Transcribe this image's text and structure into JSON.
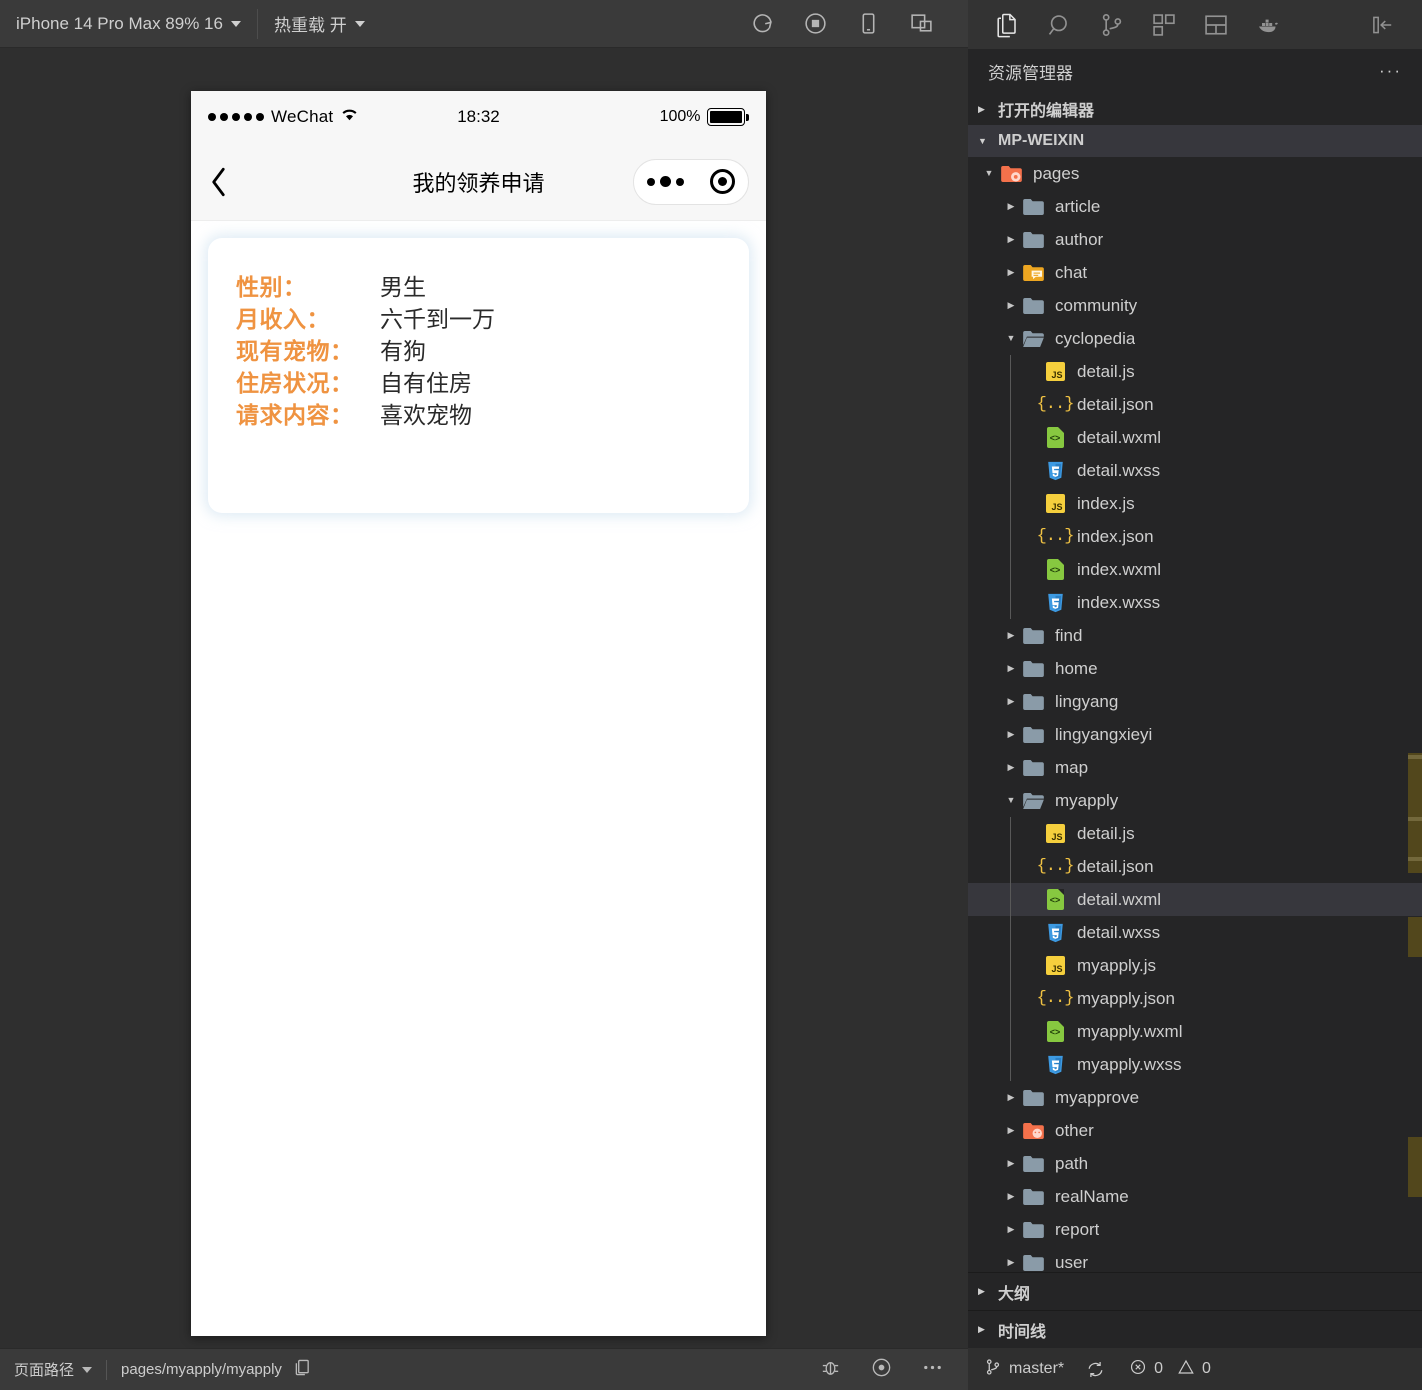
{
  "simulator": {
    "toolbar": {
      "device_label": "iPhone 14 Pro Max 89% 16",
      "hot_reload_label": "热重载 开",
      "icons": [
        "refresh-icon",
        "record-stop-icon",
        "phone-icon",
        "split-window-icon"
      ]
    },
    "phone": {
      "status_bar": {
        "carrier": "WeChat",
        "time": "18:32",
        "battery_percent": "100%"
      },
      "nav": {
        "back_icon": "chevron-left-icon",
        "title": "我的领养申请",
        "capsule": {
          "more_icon": "more-dots-icon",
          "target_icon": "target-circle-icon"
        }
      },
      "card": {
        "rows": [
          {
            "label": "性别：",
            "value": "男生"
          },
          {
            "label": "月收入：",
            "value": "六千到一万"
          },
          {
            "label": "现有宠物：",
            "value": "有狗"
          },
          {
            "label": "住房状况：",
            "value": "自有住房"
          },
          {
            "label": "请求内容：",
            "value": "喜欢宠物"
          }
        ]
      }
    },
    "bottom_bar": {
      "path_label": "页面路径",
      "path_value": "pages/myapply/myapply",
      "copy_icon": "copy-icon",
      "icons": [
        "debug-bug-icon",
        "eye-icon",
        "more-horizontal-icon"
      ]
    }
  },
  "vscode": {
    "activity_bar": {
      "items": [
        {
          "name": "explorer-icon",
          "active": true
        },
        {
          "name": "search-icon",
          "active": false
        },
        {
          "name": "source-control-icon",
          "active": false
        },
        {
          "name": "extensions-icon",
          "active": false
        },
        {
          "name": "layout-icon",
          "active": false
        },
        {
          "name": "docker-icon",
          "active": false
        }
      ],
      "collapse_icon": "collapse-panel-icon"
    },
    "panel_title": "资源管理器",
    "panel_more": "···",
    "sections": [
      {
        "label": "打开的编辑器",
        "expanded": false
      },
      {
        "label": "MP-WEIXIN",
        "expanded": true,
        "highlight": true
      }
    ],
    "tree": [
      {
        "name": "pages",
        "type": "folder-special",
        "depth": 1,
        "expanded": true
      },
      {
        "name": "article",
        "type": "folder",
        "depth": 2,
        "expanded": false
      },
      {
        "name": "author",
        "type": "folder",
        "depth": 2,
        "expanded": false
      },
      {
        "name": "chat",
        "type": "folder-chat",
        "depth": 2,
        "expanded": false
      },
      {
        "name": "community",
        "type": "folder",
        "depth": 2,
        "expanded": false
      },
      {
        "name": "cyclopedia",
        "type": "folder-open",
        "depth": 2,
        "expanded": true
      },
      {
        "name": "detail.js",
        "type": "js",
        "depth": 3
      },
      {
        "name": "detail.json",
        "type": "json",
        "depth": 3
      },
      {
        "name": "detail.wxml",
        "type": "wxml",
        "depth": 3
      },
      {
        "name": "detail.wxss",
        "type": "wxss",
        "depth": 3
      },
      {
        "name": "index.js",
        "type": "js",
        "depth": 3
      },
      {
        "name": "index.json",
        "type": "json",
        "depth": 3
      },
      {
        "name": "index.wxml",
        "type": "wxml",
        "depth": 3
      },
      {
        "name": "index.wxss",
        "type": "wxss",
        "depth": 3
      },
      {
        "name": "find",
        "type": "folder",
        "depth": 2,
        "expanded": false
      },
      {
        "name": "home",
        "type": "folder",
        "depth": 2,
        "expanded": false
      },
      {
        "name": "lingyang",
        "type": "folder",
        "depth": 2,
        "expanded": false
      },
      {
        "name": "lingyangxieyi",
        "type": "folder",
        "depth": 2,
        "expanded": false
      },
      {
        "name": "map",
        "type": "folder",
        "depth": 2,
        "expanded": false
      },
      {
        "name": "myapply",
        "type": "folder-open",
        "depth": 2,
        "expanded": true
      },
      {
        "name": "detail.js",
        "type": "js",
        "depth": 3
      },
      {
        "name": "detail.json",
        "type": "json",
        "depth": 3
      },
      {
        "name": "detail.wxml",
        "type": "wxml",
        "depth": 3,
        "selected": true
      },
      {
        "name": "detail.wxss",
        "type": "wxss",
        "depth": 3
      },
      {
        "name": "myapply.js",
        "type": "js",
        "depth": 3
      },
      {
        "name": "myapply.json",
        "type": "json",
        "depth": 3
      },
      {
        "name": "myapply.wxml",
        "type": "wxml",
        "depth": 3
      },
      {
        "name": "myapply.wxss",
        "type": "wxss",
        "depth": 3
      },
      {
        "name": "myapprove",
        "type": "folder",
        "depth": 2,
        "expanded": false
      },
      {
        "name": "other",
        "type": "folder-special2",
        "depth": 2,
        "expanded": false
      },
      {
        "name": "path",
        "type": "folder",
        "depth": 2,
        "expanded": false
      },
      {
        "name": "realName",
        "type": "folder",
        "depth": 2,
        "expanded": false
      },
      {
        "name": "report",
        "type": "folder",
        "depth": 2,
        "expanded": false
      },
      {
        "name": "user",
        "type": "folder",
        "depth": 2,
        "expanded": false
      }
    ],
    "foot_sections": [
      {
        "label": "大纲",
        "expanded": false
      },
      {
        "label": "时间线",
        "expanded": false
      }
    ],
    "status_bar": {
      "branch": "master*",
      "branch_icon": "source-control-icon",
      "sync_icon": "sync-icon",
      "errors": "0",
      "warnings": "0",
      "error_icon": "error-circle-icon",
      "warning_icon": "warning-triangle-icon"
    }
  },
  "colors": {
    "accent_orange": "#ef9341",
    "vs_bg": "#252526",
    "vs_activity": "#333333",
    "selection": "#37373d",
    "sim_bg": "#2f2f2f"
  }
}
